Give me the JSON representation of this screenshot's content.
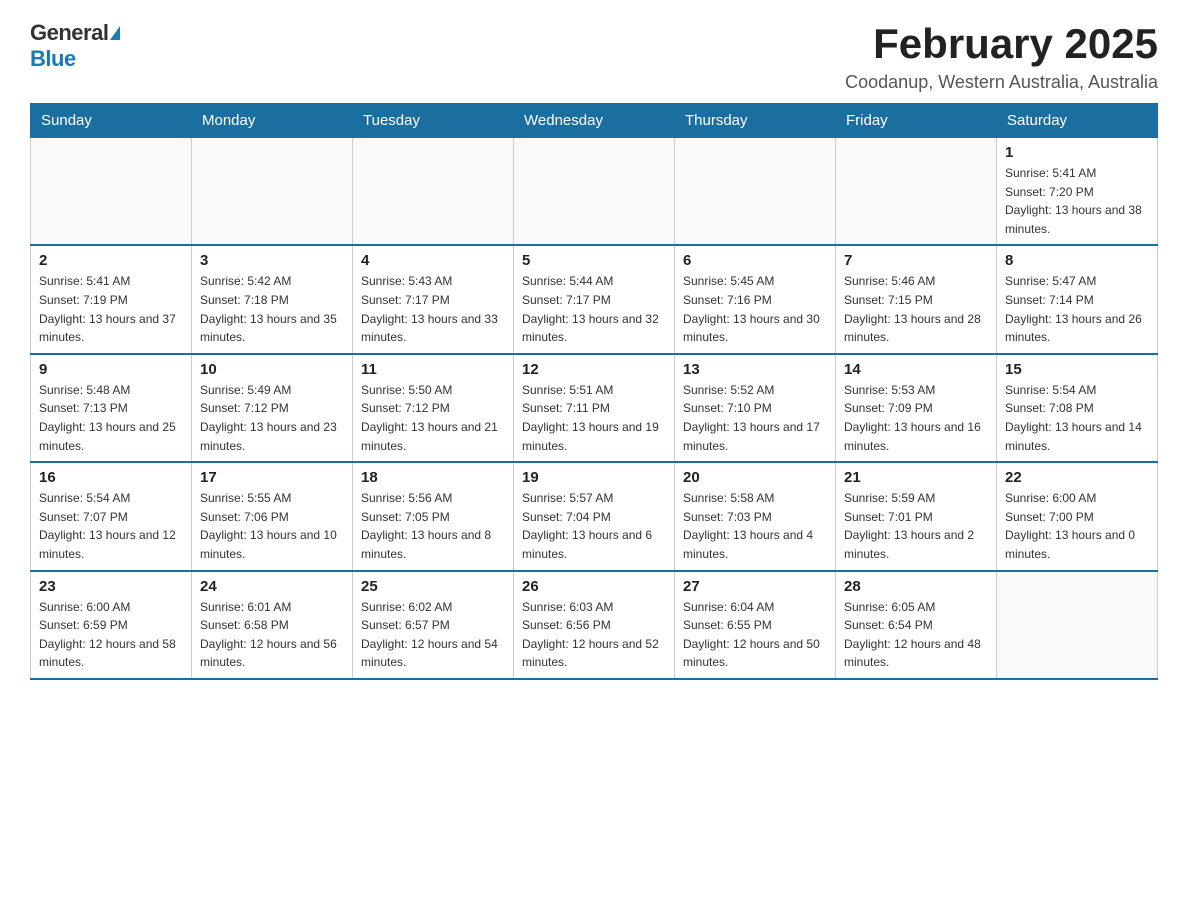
{
  "header": {
    "logo_general": "General",
    "logo_blue": "Blue",
    "title": "February 2025",
    "subtitle": "Coodanup, Western Australia, Australia"
  },
  "days_of_week": [
    "Sunday",
    "Monday",
    "Tuesday",
    "Wednesday",
    "Thursday",
    "Friday",
    "Saturday"
  ],
  "weeks": [
    [
      {
        "num": "",
        "info": ""
      },
      {
        "num": "",
        "info": ""
      },
      {
        "num": "",
        "info": ""
      },
      {
        "num": "",
        "info": ""
      },
      {
        "num": "",
        "info": ""
      },
      {
        "num": "",
        "info": ""
      },
      {
        "num": "1",
        "info": "Sunrise: 5:41 AM\nSunset: 7:20 PM\nDaylight: 13 hours and 38 minutes."
      }
    ],
    [
      {
        "num": "2",
        "info": "Sunrise: 5:41 AM\nSunset: 7:19 PM\nDaylight: 13 hours and 37 minutes."
      },
      {
        "num": "3",
        "info": "Sunrise: 5:42 AM\nSunset: 7:18 PM\nDaylight: 13 hours and 35 minutes."
      },
      {
        "num": "4",
        "info": "Sunrise: 5:43 AM\nSunset: 7:17 PM\nDaylight: 13 hours and 33 minutes."
      },
      {
        "num": "5",
        "info": "Sunrise: 5:44 AM\nSunset: 7:17 PM\nDaylight: 13 hours and 32 minutes."
      },
      {
        "num": "6",
        "info": "Sunrise: 5:45 AM\nSunset: 7:16 PM\nDaylight: 13 hours and 30 minutes."
      },
      {
        "num": "7",
        "info": "Sunrise: 5:46 AM\nSunset: 7:15 PM\nDaylight: 13 hours and 28 minutes."
      },
      {
        "num": "8",
        "info": "Sunrise: 5:47 AM\nSunset: 7:14 PM\nDaylight: 13 hours and 26 minutes."
      }
    ],
    [
      {
        "num": "9",
        "info": "Sunrise: 5:48 AM\nSunset: 7:13 PM\nDaylight: 13 hours and 25 minutes."
      },
      {
        "num": "10",
        "info": "Sunrise: 5:49 AM\nSunset: 7:12 PM\nDaylight: 13 hours and 23 minutes."
      },
      {
        "num": "11",
        "info": "Sunrise: 5:50 AM\nSunset: 7:12 PM\nDaylight: 13 hours and 21 minutes."
      },
      {
        "num": "12",
        "info": "Sunrise: 5:51 AM\nSunset: 7:11 PM\nDaylight: 13 hours and 19 minutes."
      },
      {
        "num": "13",
        "info": "Sunrise: 5:52 AM\nSunset: 7:10 PM\nDaylight: 13 hours and 17 minutes."
      },
      {
        "num": "14",
        "info": "Sunrise: 5:53 AM\nSunset: 7:09 PM\nDaylight: 13 hours and 16 minutes."
      },
      {
        "num": "15",
        "info": "Sunrise: 5:54 AM\nSunset: 7:08 PM\nDaylight: 13 hours and 14 minutes."
      }
    ],
    [
      {
        "num": "16",
        "info": "Sunrise: 5:54 AM\nSunset: 7:07 PM\nDaylight: 13 hours and 12 minutes."
      },
      {
        "num": "17",
        "info": "Sunrise: 5:55 AM\nSunset: 7:06 PM\nDaylight: 13 hours and 10 minutes."
      },
      {
        "num": "18",
        "info": "Sunrise: 5:56 AM\nSunset: 7:05 PM\nDaylight: 13 hours and 8 minutes."
      },
      {
        "num": "19",
        "info": "Sunrise: 5:57 AM\nSunset: 7:04 PM\nDaylight: 13 hours and 6 minutes."
      },
      {
        "num": "20",
        "info": "Sunrise: 5:58 AM\nSunset: 7:03 PM\nDaylight: 13 hours and 4 minutes."
      },
      {
        "num": "21",
        "info": "Sunrise: 5:59 AM\nSunset: 7:01 PM\nDaylight: 13 hours and 2 minutes."
      },
      {
        "num": "22",
        "info": "Sunrise: 6:00 AM\nSunset: 7:00 PM\nDaylight: 13 hours and 0 minutes."
      }
    ],
    [
      {
        "num": "23",
        "info": "Sunrise: 6:00 AM\nSunset: 6:59 PM\nDaylight: 12 hours and 58 minutes."
      },
      {
        "num": "24",
        "info": "Sunrise: 6:01 AM\nSunset: 6:58 PM\nDaylight: 12 hours and 56 minutes."
      },
      {
        "num": "25",
        "info": "Sunrise: 6:02 AM\nSunset: 6:57 PM\nDaylight: 12 hours and 54 minutes."
      },
      {
        "num": "26",
        "info": "Sunrise: 6:03 AM\nSunset: 6:56 PM\nDaylight: 12 hours and 52 minutes."
      },
      {
        "num": "27",
        "info": "Sunrise: 6:04 AM\nSunset: 6:55 PM\nDaylight: 12 hours and 50 minutes."
      },
      {
        "num": "28",
        "info": "Sunrise: 6:05 AM\nSunset: 6:54 PM\nDaylight: 12 hours and 48 minutes."
      },
      {
        "num": "",
        "info": ""
      }
    ]
  ]
}
